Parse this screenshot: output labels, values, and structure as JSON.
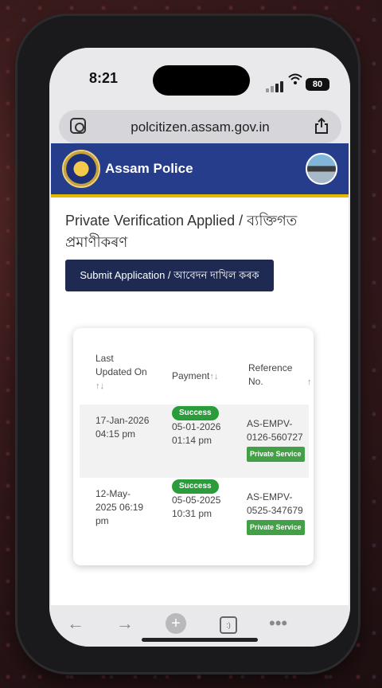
{
  "status_bar": {
    "time": "8:21",
    "battery": "80"
  },
  "browser": {
    "url": "polcitizen.assam.gov.in"
  },
  "site": {
    "brand": "Assam Police",
    "page_title": "Private Verification Applied / ব্যক্তিগত প্ৰমাণীকৰণ",
    "submit_label": "Submit Application / আবেদন দাখিল কৰক"
  },
  "table": {
    "headers": {
      "last_updated": "Last Updated On",
      "payment": "Payment",
      "reference": "Reference No."
    },
    "sort_glyph": "↑↓",
    "sort_single": "↑",
    "rows": [
      {
        "last_updated": "17-Jan-2026 04:15 pm",
        "payment_status": "Success",
        "payment_date": "05-01-2026 01:14 pm",
        "reference": "AS-EMPV-0126-560727",
        "service": "Private Service"
      },
      {
        "last_updated": "12-May-2025 06:19 pm",
        "payment_status": "Success",
        "payment_date": "05-05-2025 10:31 pm",
        "reference": "AS-EMPV-0525-347679",
        "service": "Private Service"
      }
    ]
  },
  "toolbar": {
    "back": "←",
    "forward": "→",
    "new_tab": "+",
    "tabs": ":)",
    "more": "•••"
  },
  "colors": {
    "header_bg": "#263d8c",
    "submit_bg": "#1f2a52",
    "success": "#2a9d3a",
    "service": "#43a047"
  }
}
